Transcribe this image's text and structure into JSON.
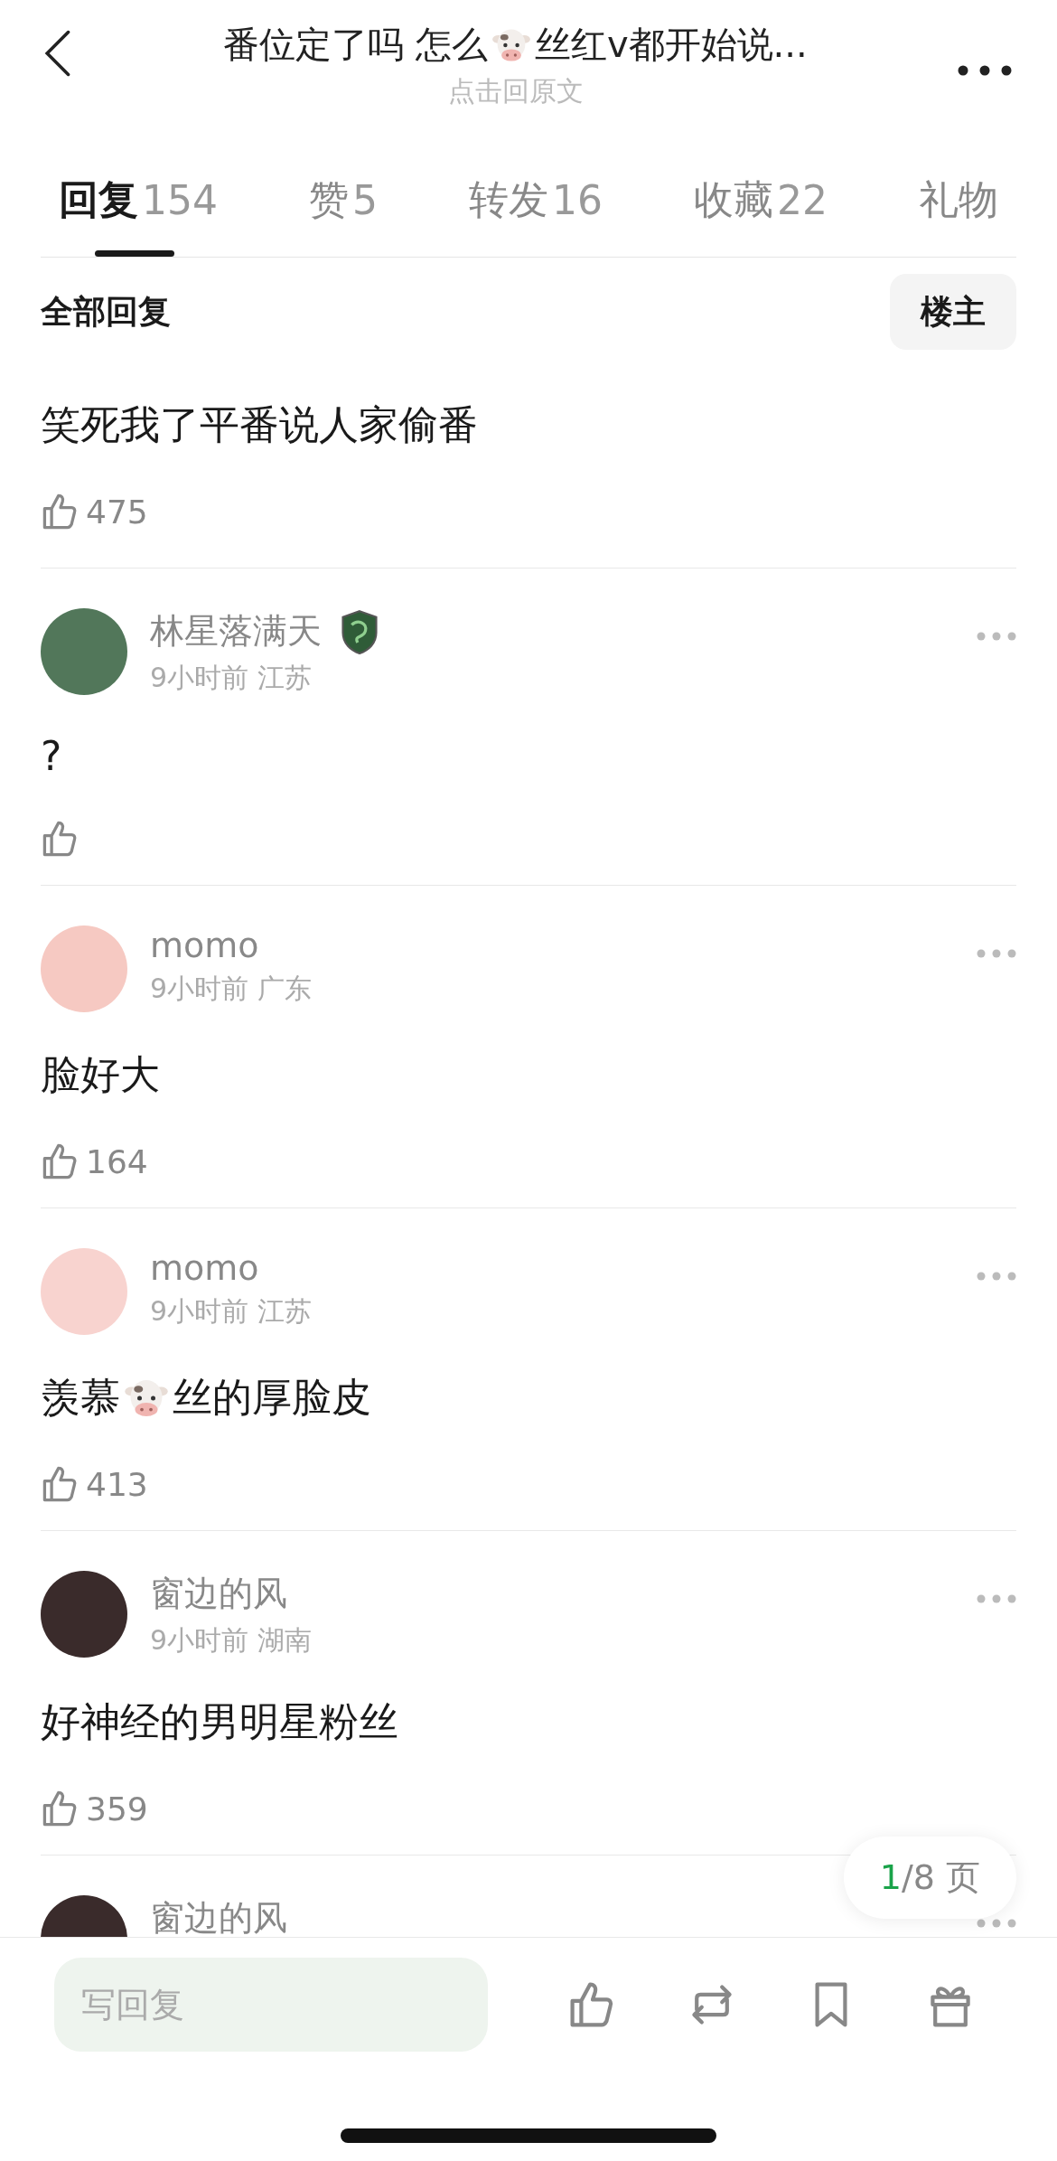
{
  "header": {
    "title_parts": [
      {
        "kind": "text",
        "text": "番位定了吗 怎么"
      },
      {
        "kind": "cow"
      },
      {
        "kind": "text",
        "text": "丝红v都开始说..."
      }
    ],
    "subtitle": "点击回原文"
  },
  "tabs": [
    {
      "label": "回复",
      "count": "154",
      "selected": true
    },
    {
      "label": "赞",
      "count": "5",
      "selected": false
    },
    {
      "label": "转发",
      "count": "16",
      "selected": false
    },
    {
      "label": "收藏",
      "count": "22",
      "selected": false
    },
    {
      "label": "礼物",
      "selected": false
    }
  ],
  "filter": {
    "title": "全部回复",
    "button": "楼主"
  },
  "quote": {
    "text": "笑死我了平番说人家偷番",
    "likes": "475"
  },
  "comments": [
    {
      "name": "林星落满天",
      "has_badge": true,
      "color": "#52775a",
      "meta": "9小时前 江苏",
      "content": [
        {
          "kind": "text",
          "text": "?"
        }
      ]
    },
    {
      "name": "momo",
      "has_badge": false,
      "color": "#f6c9c2",
      "meta": "9小时前 广东",
      "content": [
        {
          "kind": "text",
          "text": "脸好大"
        }
      ],
      "likes": "164"
    },
    {
      "name": "momo",
      "has_badge": false,
      "color": "#f8d3cf",
      "meta": "9小时前 江苏",
      "content": [
        {
          "kind": "text",
          "text": "羡慕"
        },
        {
          "kind": "cow"
        },
        {
          "kind": "text",
          "text": "丝的厚脸皮"
        }
      ],
      "likes": "413"
    },
    {
      "name": "窗边的风",
      "has_badge": false,
      "color": "#3a2b2b",
      "meta": "9小时前 湖南",
      "content": [
        {
          "kind": "text",
          "text": "好神经的男明星粉丝"
        }
      ],
      "likes": "359"
    },
    {
      "name": "窗边的风",
      "has_badge": false,
      "color": "#3a2b2b"
    }
  ],
  "pager": {
    "current": "1",
    "rest": "/8 页"
  },
  "reply": {
    "placeholder": "写回复"
  }
}
